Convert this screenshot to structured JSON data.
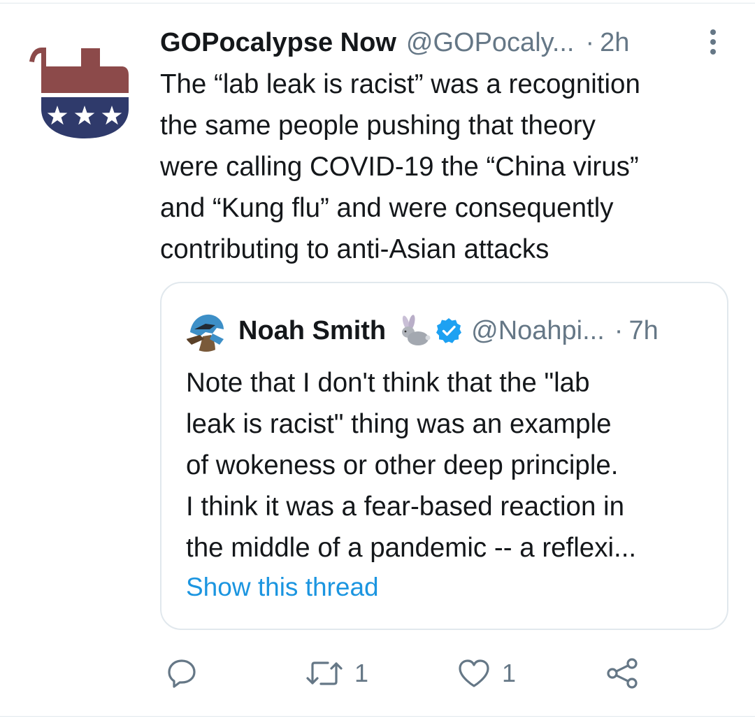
{
  "tweet": {
    "display_name": "GOPocalypse Now",
    "handle": "@GOPocaly...",
    "separator": "·",
    "timestamp": "2h",
    "avatar_icon": "elephant-logo-icon",
    "body_lines": [
      "The “lab leak is racist” was a recognition",
      "the same people pushing that theory",
      "were calling COVID-19 the “China virus”",
      "and “Kung flu” and were consequently",
      "contributing to anti-Asian attacks"
    ]
  },
  "quote": {
    "display_name": "Noah Smith",
    "handle": "@Noahpi...",
    "separator": "·",
    "timestamp": "7h",
    "name_emoji_icon": "rabbit-icon",
    "verified_icon": "verified-badge-icon",
    "body_lines": [
      "Note that I don't think that the \"lab",
      "leak is racist\" thing was an example",
      "of wokeness or other deep principle.",
      "I think it was a fear-based reaction in",
      "the middle of a pandemic -- a reflexi..."
    ],
    "show_thread_label": "Show this thread"
  },
  "actions": {
    "reply_icon": "reply-icon",
    "retweet_icon": "retweet-icon",
    "retweet_count": "1",
    "like_icon": "heart-icon",
    "like_count": "1",
    "share_icon": "share-icon"
  },
  "colors": {
    "text_primary": "#14171a",
    "text_secondary": "#657786",
    "link": "#1b95e0",
    "verified": "#1da1f2",
    "border": "#e1e8ed",
    "avatar_elephant": "#8c4a4a",
    "avatar_band": "#2f3a6b"
  }
}
